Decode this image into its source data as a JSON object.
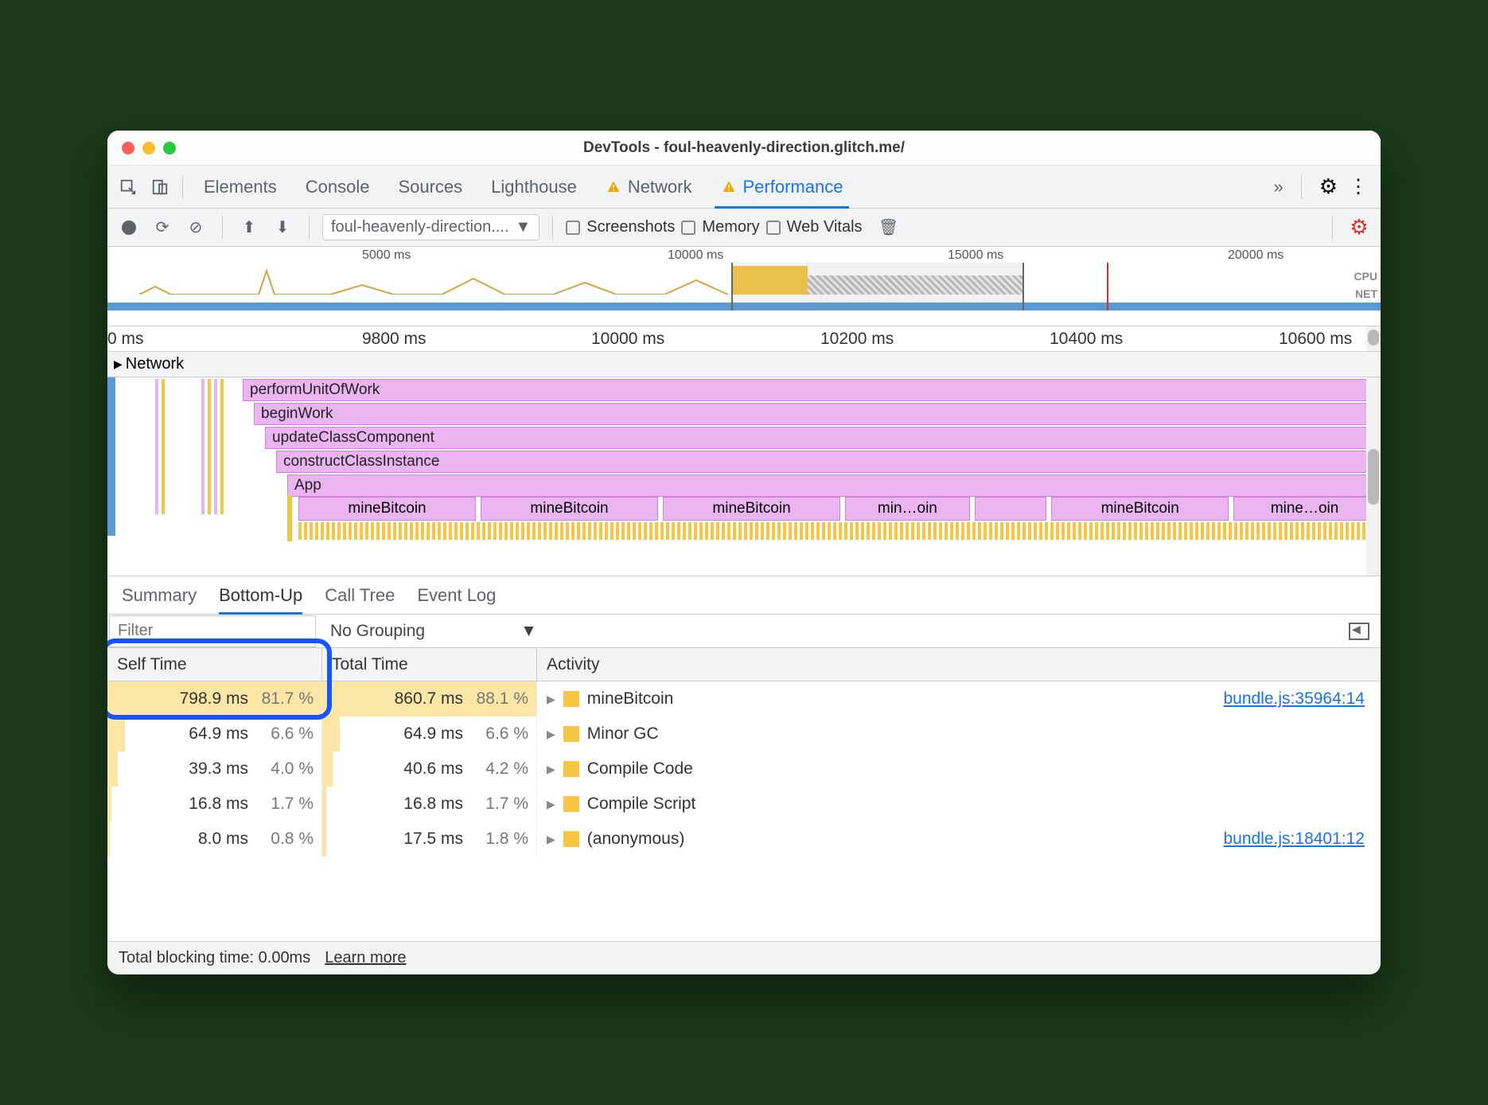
{
  "window": {
    "title": "DevTools - foul-heavenly-direction.glitch.me/"
  },
  "tabs": {
    "items": [
      "Elements",
      "Console",
      "Sources",
      "Lighthouse",
      "Network",
      "Performance"
    ],
    "active": "Performance",
    "warning_tabs": [
      "Network",
      "Performance"
    ]
  },
  "toolbar": {
    "recording_select": "foul-heavenly-direction....",
    "checkboxes": {
      "screenshots": "Screenshots",
      "memory": "Memory",
      "webvitals": "Web Vitals"
    }
  },
  "overview": {
    "ticks": [
      "5000 ms",
      "10000 ms",
      "15000 ms",
      "20000 ms"
    ],
    "labels": {
      "cpu": "CPU",
      "net": "NET"
    },
    "sub_tick": "1s"
  },
  "ruler": [
    "0 ms",
    "9800 ms",
    "10000 ms",
    "10200 ms",
    "10400 ms",
    "10600 ms"
  ],
  "network_row": "Network",
  "flame": {
    "stack": [
      "performUnitOfWork",
      "beginWork",
      "updateClassComponent",
      "constructClassInstance",
      "App"
    ],
    "bitcoins": [
      "mineBitcoin",
      "mineBitcoin",
      "mineBitcoin",
      "min…oin",
      "",
      "mineBitcoin",
      "mine…oin"
    ]
  },
  "subtabs": {
    "items": [
      "Summary",
      "Bottom-Up",
      "Call Tree",
      "Event Log"
    ],
    "active": "Bottom-Up"
  },
  "filter": {
    "placeholder": "Filter",
    "grouping": "No Grouping"
  },
  "columns": {
    "self": "Self Time",
    "total": "Total Time",
    "activity": "Activity"
  },
  "rows": [
    {
      "self_ms": "798.9 ms",
      "self_pct": "81.7 %",
      "self_bar": 100,
      "total_ms": "860.7 ms",
      "total_pct": "88.1 %",
      "total_bar": 100,
      "activity": "mineBitcoin",
      "src": "bundle.js:35964:14"
    },
    {
      "self_ms": "64.9 ms",
      "self_pct": "6.6 %",
      "self_bar": 8,
      "total_ms": "64.9 ms",
      "total_pct": "6.6 %",
      "total_bar": 8,
      "activity": "Minor GC",
      "src": ""
    },
    {
      "self_ms": "39.3 ms",
      "self_pct": "4.0 %",
      "self_bar": 5,
      "total_ms": "40.6 ms",
      "total_pct": "4.2 %",
      "total_bar": 5,
      "activity": "Compile Code",
      "src": ""
    },
    {
      "self_ms": "16.8 ms",
      "self_pct": "1.7 %",
      "self_bar": 2,
      "total_ms": "16.8 ms",
      "total_pct": "1.7 %",
      "total_bar": 2,
      "activity": "Compile Script",
      "src": ""
    },
    {
      "self_ms": "8.0 ms",
      "self_pct": "0.8 %",
      "self_bar": 1,
      "total_ms": "17.5 ms",
      "total_pct": "1.8 %",
      "total_bar": 2,
      "activity": "(anonymous)",
      "src": "bundle.js:18401:12"
    }
  ],
  "footer": {
    "blocking": "Total blocking time: 0.00ms",
    "learn": "Learn more"
  }
}
